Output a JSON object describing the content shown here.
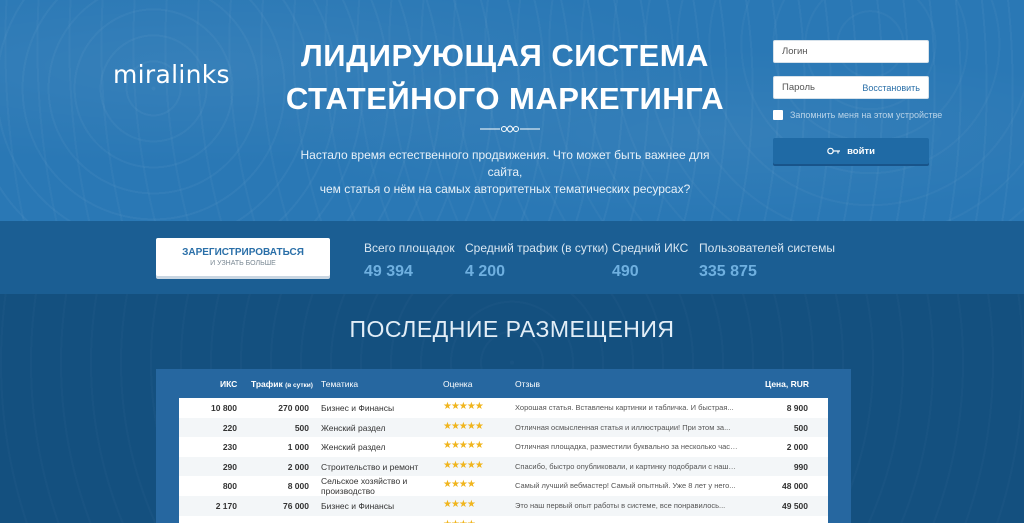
{
  "brand": {
    "logo": "miralinks"
  },
  "hero": {
    "headline_line1": "ЛИДИРУЮЩАЯ СИСТЕМА",
    "headline_line2": "СТАТЕЙНОГО МАРКЕТИНГА",
    "subtitle_line1": "Настало время естественного продвижения. Что может быть важнее для сайта,",
    "subtitle_line2": "чем статья о нём на самых авторитетных тематических ресурсах?"
  },
  "login": {
    "login_placeholder": "Логин",
    "password_placeholder": "Пароль",
    "restore_link": "Восстановить",
    "remember_label": "Запомнить меня на этом устройстве",
    "submit_label": "войти"
  },
  "register": {
    "title": "ЗАРЕГИСТРИРОВАТЬСЯ",
    "subtitle": "И УЗНАТЬ БОЛЬШЕ"
  },
  "stats": [
    {
      "label": "Всего площадок",
      "value": "49 394"
    },
    {
      "label": "Средний трафик (в сутки)",
      "value": "4 200"
    },
    {
      "label": "Средний ИКС",
      "value": "490"
    },
    {
      "label": "Пользователей системы",
      "value": "335 875"
    }
  ],
  "placements": {
    "title": "ПОСЛЕДНИЕ РАЗМЕЩЕНИЯ",
    "headers": {
      "iks": "ИКС",
      "traffic": "Трафик",
      "traffic_unit": "(в сутки)",
      "theme": "Тематика",
      "rating": "Оценка",
      "review": "Отзыв",
      "price": "Цена, RUR"
    },
    "rows": [
      {
        "iks": "10 800",
        "traffic": "270 000",
        "theme": "Бизнес и Финансы",
        "stars": "★★★★★",
        "review": "Хорошая статья. Вставлены картинки и табличка. И быстрая...",
        "price": "8 900"
      },
      {
        "iks": "220",
        "traffic": "500",
        "theme": "Женский раздел",
        "stars": "★★★★★",
        "review": "Отличная осмысленная статья и иллюстрации! При этом за...",
        "price": "500"
      },
      {
        "iks": "230",
        "traffic": "1 000",
        "theme": "Женский раздел",
        "stars": "★★★★★",
        "review": "Отличная площадка, разместили буквально за несколько часов...",
        "price": "2 000"
      },
      {
        "iks": "290",
        "traffic": "2 000",
        "theme": "Строительство и ремонт",
        "stars": "★★★★★",
        "review": "Спасибо, быстро опубликовали, и картинку подобрали с нашего...",
        "price": "990"
      },
      {
        "iks": "800",
        "traffic": "8 000",
        "theme": "Сельское хозяйство и производство",
        "stars": "★★★★",
        "review": "Самый лучший вебмастер! Самый опытный. Уже 8 лет у него...",
        "price": "48 000"
      },
      {
        "iks": "2 170",
        "traffic": "76 000",
        "theme": "Бизнес и Финансы",
        "stars": "★★★★",
        "review": "Это наш первый опыт работы в системе, все понравилось...",
        "price": "49 500"
      },
      {
        "iks": "",
        "traffic": "",
        "theme": "Компьютеры и компьютерные",
        "stars": "★★★★",
        "review": "",
        "price": ""
      }
    ]
  }
}
